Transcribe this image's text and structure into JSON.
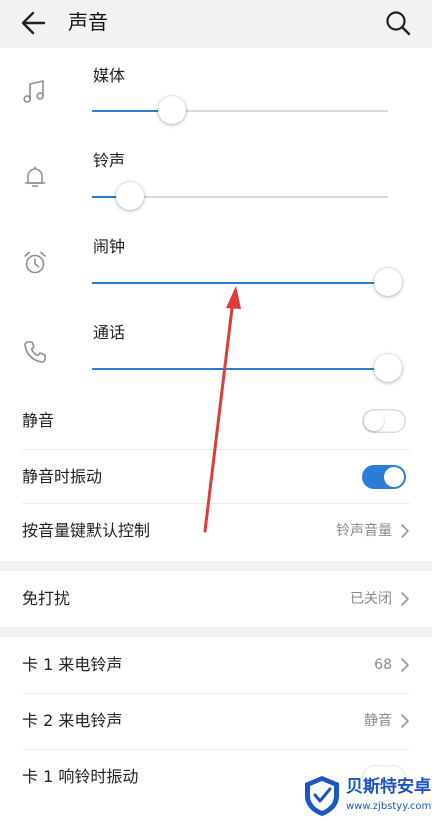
{
  "header": {
    "title": "声音",
    "back_icon": "arrow-left-icon",
    "search_icon": "search-icon"
  },
  "volume": [
    {
      "label": "媒体",
      "icon": "music-note-icon",
      "level": 0.27
    },
    {
      "label": "铃声",
      "icon": "bell-icon",
      "level": 0.13
    },
    {
      "label": "闹钟",
      "icon": "alarm-clock-icon",
      "level": 1.0
    },
    {
      "label": "通话",
      "icon": "phone-icon",
      "level": 1.0
    }
  ],
  "settings": {
    "mute": {
      "label": "静音",
      "on": false
    },
    "vibrate_on_mute": {
      "label": "静音时振动",
      "on": true
    },
    "volume_key_default": {
      "label": "按音量键默认控制",
      "value": "铃声音量"
    }
  },
  "dnd": {
    "label": "免打扰",
    "value": "已关闭"
  },
  "sim": {
    "card1_ringtone": {
      "label": "卡 1 来电铃声",
      "value": "68"
    },
    "card2_ringtone": {
      "label": "卡 2 来电铃声",
      "value": "静音"
    },
    "card1_vibrate": {
      "label": "卡 1 响铃时振动",
      "on": false
    }
  },
  "watermark": {
    "name": "贝斯特安卓网",
    "url": "www.zjbstyy.com"
  },
  "colors": {
    "accent": "#2b7bd8",
    "annotation": "#e03a3a",
    "background": "#f2f2f2",
    "watermark": "#1a56c4"
  }
}
